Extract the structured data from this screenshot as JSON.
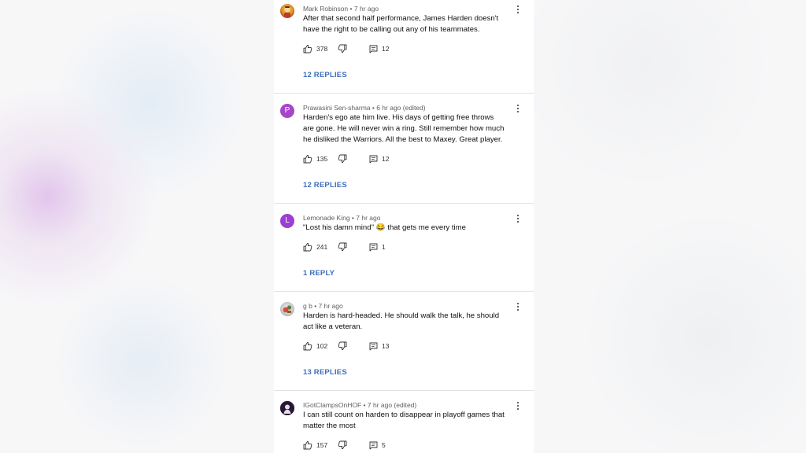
{
  "comments": [
    {
      "author": "Mark Robinson",
      "time": "7 hr ago",
      "avatar_letter": "",
      "text": "After that second half performance, James Harden doesn't have the right to be calling out any of his teammates.",
      "likes": "378",
      "reply_count": "12",
      "replies_label": "12 REPLIES"
    },
    {
      "author": "Prawasini Sen-sharma",
      "time": "6 hr ago (edited)",
      "avatar_letter": "P",
      "text": "Harden's ego ate him live. His days of getting free throws are gone. He will never win a ring. Still remember how much he disliked the Warriors. All the best to Maxey. Great player.",
      "likes": "135",
      "reply_count": "12",
      "replies_label": "12 REPLIES"
    },
    {
      "author": "Lemonade King",
      "time": "7 hr ago",
      "avatar_letter": "L",
      "text": "\"Lost his damn mind\" 😂 that gets me every time",
      "likes": "241",
      "reply_count": "1",
      "replies_label": "1 REPLY"
    },
    {
      "author": "g b",
      "time": "7 hr ago",
      "avatar_letter": "",
      "text": "Harden is hard-headed. He should walk the talk, he should act like a veteran.",
      "likes": "102",
      "reply_count": "13",
      "replies_label": "13 REPLIES"
    },
    {
      "author": "IGotClampsOnHOF",
      "time": "7 hr ago (edited)",
      "avatar_letter": "",
      "text": "I can still count on harden to disappear in playoff games that matter the most",
      "likes": "157",
      "reply_count": "5",
      "replies_label": ""
    }
  ],
  "separator": " • ",
  "colors": {
    "avatar_p": "#a647c9",
    "avatar_l": "#9b3fd0",
    "replies_link": "#3e6fbd",
    "divider": "#e3e3e3"
  },
  "icons": [
    "thumbs-up-icon",
    "thumbs-down-icon",
    "comment-icon",
    "more-vert-icon"
  ]
}
